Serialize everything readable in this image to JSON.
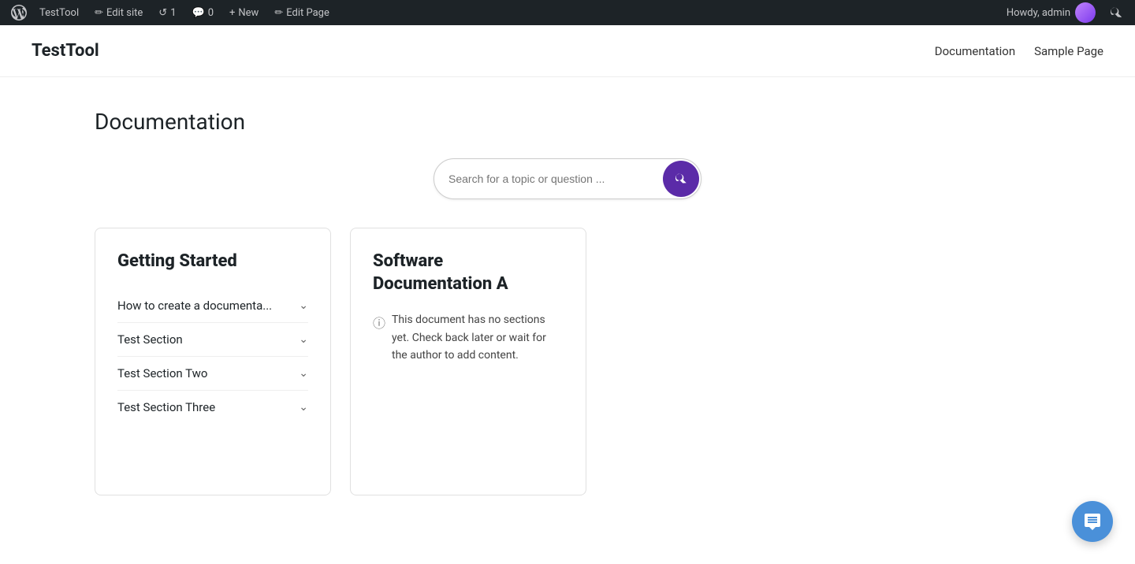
{
  "adminBar": {
    "wpIcon": "WordPress Logo",
    "siteName": "TestTool",
    "editSite": "Edit site",
    "updates": "1",
    "comments": "0",
    "new": "New",
    "editPage": "Edit Page",
    "howdy": "Howdy, admin",
    "searchTitle": "Search"
  },
  "siteHeader": {
    "title": "TestTool",
    "nav": [
      {
        "label": "Documentation"
      },
      {
        "label": "Sample Page"
      }
    ]
  },
  "main": {
    "pageTitle": "Documentation",
    "search": {
      "placeholder": "Search for a topic or question ...",
      "buttonLabel": "Search"
    },
    "cards": [
      {
        "id": "getting-started",
        "title": "Getting Started",
        "sections": [
          {
            "label": "How to create a documenta..."
          },
          {
            "label": "Test Section"
          },
          {
            "label": "Test Section Two"
          },
          {
            "label": "Test Section Three"
          }
        ]
      },
      {
        "id": "software-doc-a",
        "title": "Software Documentation A",
        "emptyMessage": "This document has no sections yet. Check back later or wait for the author to add content."
      }
    ]
  },
  "chatFab": {
    "label": "Chat"
  }
}
